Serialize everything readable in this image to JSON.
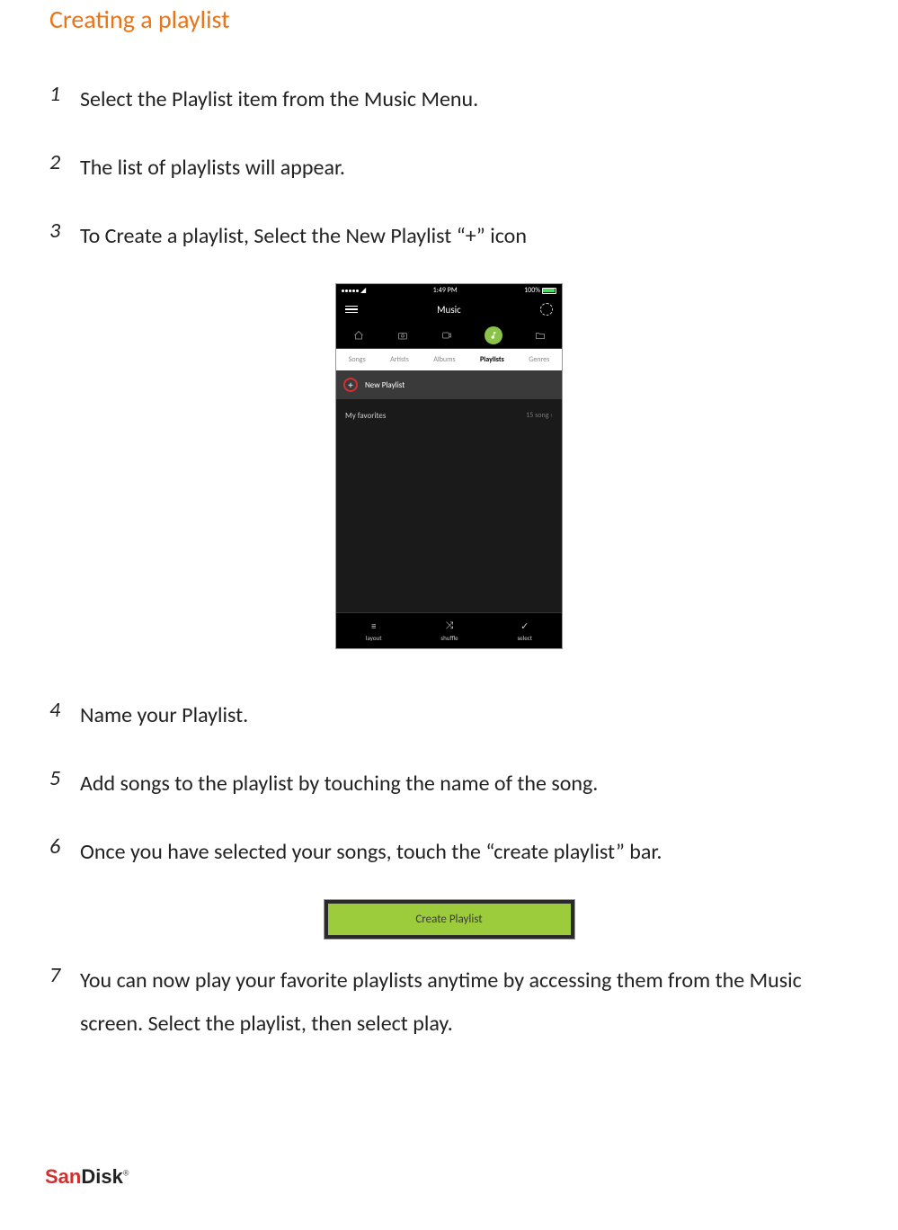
{
  "title": "Creating a playlist",
  "steps": [
    {
      "n": "1",
      "text": "Select the Playlist item from the Music Menu."
    },
    {
      "n": "2",
      "text": "The list of playlists will appear."
    },
    {
      "n": "3",
      "text": "To Create a playlist, Select the New Playlist  “+” icon"
    },
    {
      "n": "4",
      "text": "Name your Playlist."
    },
    {
      "n": "5",
      "text": "Add songs to the playlist by touching the name of the song."
    },
    {
      "n": "6",
      "text": "Once you have selected your songs, touch the “create playlist” bar."
    },
    {
      "n": "7",
      "text": "You can now play your favorite playlists anytime by accessing them from the Music screen. Select the playlist, then select play."
    }
  ],
  "screenshot": {
    "status_time": "1:49 PM",
    "battery": "100%",
    "app_title": "Music",
    "sub_tabs": [
      "Songs",
      "Artists",
      "Albums",
      "Playlists",
      "Genres"
    ],
    "active_tab": "Playlists",
    "new_playlist_label": "New Playlist",
    "playlist": {
      "name": "My favorites",
      "meta": "15 song  ›"
    },
    "bottom": [
      {
        "icon": "≡",
        "label": "layout"
      },
      {
        "icon": "⤨",
        "label": "shuffle"
      },
      {
        "icon": "✓",
        "label": "select"
      }
    ]
  },
  "create_bar_label": "Create Playlist",
  "logo": {
    "part1": "San",
    "part2": "Disk"
  }
}
